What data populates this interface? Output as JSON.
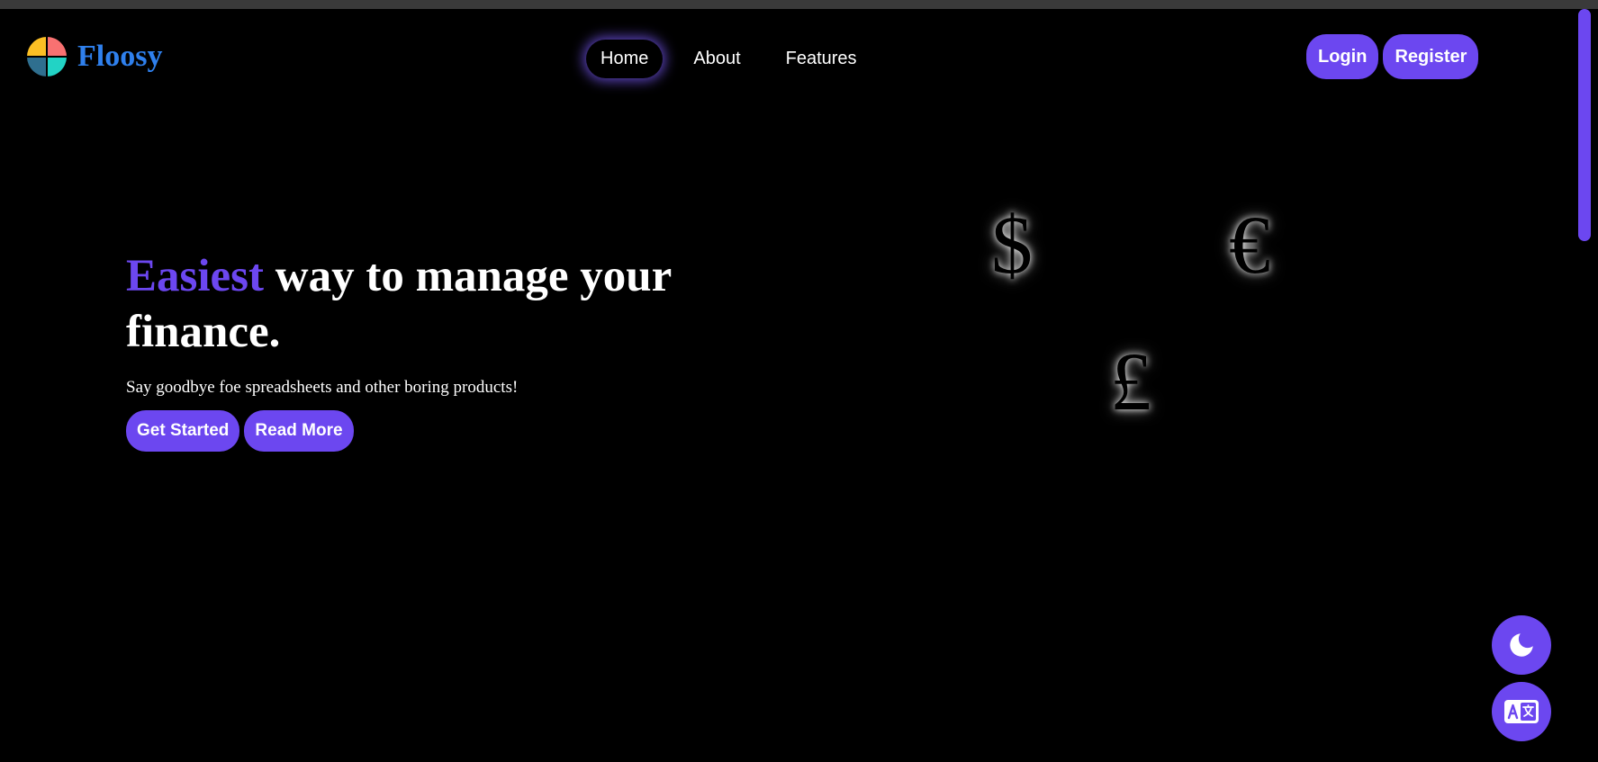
{
  "brand": {
    "name": "Floosy",
    "logo_colors": [
      "#fbbf24",
      "#f87171",
      "#2f6f8f",
      "#22d3c5"
    ],
    "name_color": "#2f80ed"
  },
  "nav": {
    "items": [
      {
        "label": "Home",
        "active": true
      },
      {
        "label": "About",
        "active": false
      },
      {
        "label": "Features",
        "active": false
      }
    ]
  },
  "auth": {
    "login_label": "Login",
    "register_label": "Register"
  },
  "hero": {
    "title_accent": "Easiest",
    "title_rest": " way to manage your finance.",
    "subtitle": "Say goodbye foe spreadsheets and other boring products!",
    "primary_cta": "Get Started",
    "secondary_cta": "Read More"
  },
  "symbols": {
    "dollar": "$",
    "euro": "€",
    "pound": "£"
  },
  "floating": {
    "theme_icon": "moon-icon",
    "language_icon": "translate-icon"
  },
  "colors": {
    "accent": "#6c47f0",
    "background": "#000000",
    "text": "#ffffff"
  }
}
